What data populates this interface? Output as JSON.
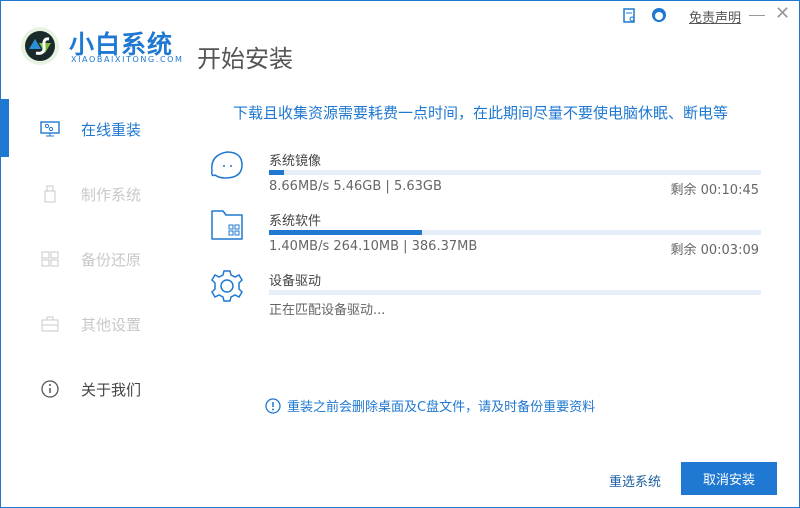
{
  "app": {
    "logo_cn": "小白系统",
    "logo_en": "XIAOBAIXITONG.COM",
    "page_title": "开始安装"
  },
  "titlebar": {
    "disclaimer": "免责声明",
    "icons": [
      "document-search-icon",
      "support-headset-icon",
      "minimize-icon",
      "close-icon"
    ]
  },
  "sidebar": {
    "items": [
      {
        "label": "在线重装",
        "icon": "monitor-icon",
        "active": true
      },
      {
        "label": "制作系统",
        "icon": "usb-drive-icon",
        "active": false
      },
      {
        "label": "备份还原",
        "icon": "grid-icon",
        "active": false
      },
      {
        "label": "其他设置",
        "icon": "briefcase-icon",
        "active": false
      },
      {
        "label": "关于我们",
        "icon": "info-icon",
        "active": false
      }
    ]
  },
  "main": {
    "notice": "下载且收集资源需要耗费一点时间，在此期间尽量不要使电脑休眠、断电等",
    "tasks": [
      {
        "title": "系统镜像",
        "icon": "chat-bubble-icon",
        "progress_percent": 3,
        "stats": "8.66MB/s 5.46GB | 5.63GB",
        "remaining": "剩余 00:10:45"
      },
      {
        "title": "系统软件",
        "icon": "folder-apps-icon",
        "progress_percent": 31,
        "stats": "1.40MB/s 264.10MB | 386.37MB",
        "remaining": "剩余 00:03:09"
      },
      {
        "title": "设备驱动",
        "icon": "gear-icon",
        "progress_percent": 0,
        "stats": "正在匹配设备驱动...",
        "remaining": ""
      }
    ],
    "warning": "重装之前会删除桌面及C盘文件，请及时备份重要资料"
  },
  "footer": {
    "reselect": "重选系统",
    "cancel": "取消安装"
  },
  "colors": {
    "accent": "#1f78d1",
    "track": "#e6eef9"
  }
}
